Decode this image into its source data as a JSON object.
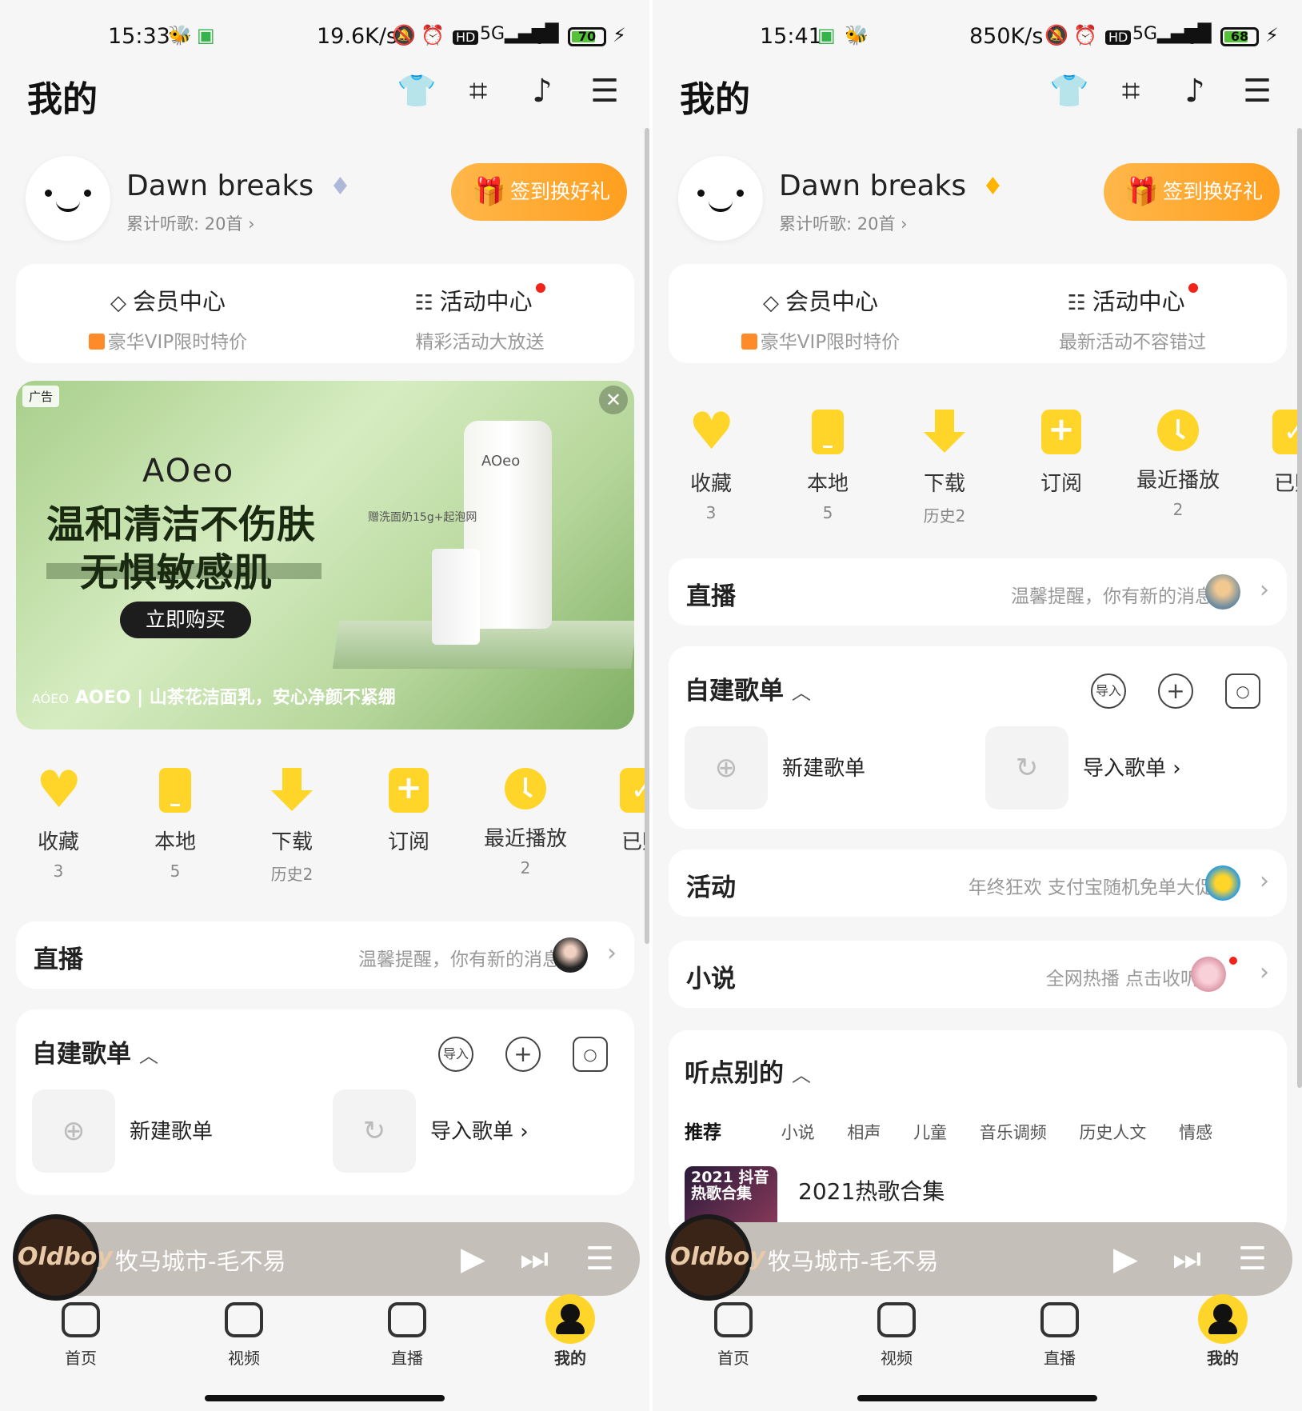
{
  "left": {
    "status": {
      "time": "15:33",
      "net": "19.6K/s",
      "battery": "70"
    },
    "header": {
      "title": "我的"
    },
    "profile": {
      "name": "Dawn breaks",
      "listen": "累计听歌: 20首 ›",
      "checkin": "签到换好礼"
    },
    "vip": {
      "member_title": "会员中心",
      "member_sub": "豪华VIP限时特价",
      "activity_title": "活动中心",
      "activity_sub": "精彩活动大放送"
    },
    "ad": {
      "tag": "广告",
      "close": "✕",
      "brand": "AOeo",
      "line1": "温和清洁不伤肤",
      "line2": "无惧敏感肌",
      "buy": "立即购买",
      "gift": "赠洗面奶15g+起泡网",
      "tube_brand": "AOeo",
      "caption_logo": "AÓEO",
      "caption": "AOEO | 山茶花洁面乳，安心净颜不紧绷"
    },
    "quick": [
      {
        "label": "收藏",
        "count": "3"
      },
      {
        "label": "本地",
        "count": "5"
      },
      {
        "label": "下载",
        "count": "历史2"
      },
      {
        "label": "订阅",
        "count": ""
      },
      {
        "label": "最近播放",
        "count": "2"
      },
      {
        "label": "已购",
        "count": ""
      }
    ],
    "live": {
      "title": "直播",
      "sub": "温馨提醒，你有新的消息"
    },
    "playlist": {
      "title": "自建歌单",
      "import_btn": "导入",
      "new": "新建歌单",
      "import": "导入歌单 ›"
    },
    "player": {
      "song": "牧马城市-毛不易",
      "cover": "Oldboy"
    },
    "nav": [
      {
        "label": "首页"
      },
      {
        "label": "视频"
      },
      {
        "label": "直播"
      },
      {
        "label": "我的"
      }
    ]
  },
  "right": {
    "status": {
      "time": "15:41",
      "net": "850K/s",
      "battery": "68"
    },
    "header": {
      "title": "我的"
    },
    "profile": {
      "name": "Dawn breaks",
      "listen": "累计听歌: 20首 ›",
      "checkin": "签到换好礼"
    },
    "vip": {
      "member_title": "会员中心",
      "member_sub": "豪华VIP限时特价",
      "activity_title": "活动中心",
      "activity_sub": "最新活动不容错过"
    },
    "quick": [
      {
        "label": "收藏",
        "count": "3"
      },
      {
        "label": "本地",
        "count": "5"
      },
      {
        "label": "下载",
        "count": "历史2"
      },
      {
        "label": "订阅",
        "count": ""
      },
      {
        "label": "最近播放",
        "count": "2"
      },
      {
        "label": "已购",
        "count": ""
      }
    ],
    "live": {
      "title": "直播",
      "sub": "温馨提醒，你有新的消息"
    },
    "playlist": {
      "title": "自建歌单",
      "import_btn": "导入",
      "new": "新建歌单",
      "import": "导入歌单 ›"
    },
    "activity": {
      "title": "活动",
      "sub": "年终狂欢 支付宝随机免单大促"
    },
    "novel": {
      "title": "小说",
      "sub": "全网热播 点击收听"
    },
    "listen_other": {
      "title": "听点别的",
      "tabs": [
        "推荐",
        "小说",
        "相声",
        "儿童",
        "音乐调频",
        "历史人文",
        "情感"
      ],
      "song_cover": "2021 抖音热歌合集",
      "song_name": "2021热歌合集"
    },
    "player": {
      "song": "牧马城市-毛不易",
      "cover": "Oldboy"
    },
    "nav": [
      {
        "label": "首页"
      },
      {
        "label": "视频"
      },
      {
        "label": "直播"
      },
      {
        "label": "我的"
      }
    ]
  },
  "icons": [
    "tshirt-icon",
    "scan-icon",
    "recognize-icon",
    "menu-icon",
    "diamond-icon",
    "gift-icon",
    "heart-icon",
    "phone-icon",
    "download-icon",
    "subscribe-icon",
    "clock-icon",
    "check-icon",
    "play-icon",
    "next-icon",
    "playlist-icon",
    "home-icon",
    "video-icon",
    "camera-icon",
    "user-icon"
  ],
  "colors": {
    "accent": "#ffd52a",
    "checkin": "#ffa72e",
    "red_dot": "#f0241a",
    "player_bg": "#c4bfb8"
  }
}
